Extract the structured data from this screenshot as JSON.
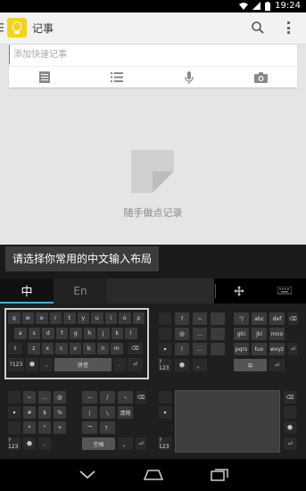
{
  "status": {
    "time": "19:24"
  },
  "app": {
    "title": "记事"
  },
  "note": {
    "placeholder": "添加快速记事"
  },
  "empty": {
    "text": "随手做点记录"
  },
  "keyboard": {
    "tooltip": "请选择你常用的中文输入布局",
    "tab_cn": "中",
    "tab_en": "En"
  },
  "layouts": {
    "qwerty": {
      "row1": [
        "q",
        "w",
        "e",
        "r",
        "t",
        "y",
        "u",
        "i",
        "o",
        "p"
      ],
      "row2": [
        "a",
        "s",
        "d",
        "f",
        "g",
        "h",
        "j",
        "k",
        "l"
      ],
      "row3": [
        "z",
        "x",
        "c",
        "v",
        "b",
        "n",
        "m"
      ],
      "row4": [
        "?123",
        "☻",
        ",",
        "拼音",
        ".",
        "⏎"
      ]
    },
    "nine_key": {
      "left": [
        "—",
        "~",
        "……"
      ],
      "row1": [
        "?",
        "~",
        "\"/",
        "abc",
        "def"
      ],
      "row2": [
        "@",
        "…",
        "ghi",
        "jkl",
        "mno"
      ],
      "row3": [
        "!",
        "…",
        "pqrs",
        "tuv",
        "wxyz"
      ],
      "row4": [
        "?123",
        "☻",
        "。",
        "中",
        "⏎"
      ]
    },
    "stroke": {
      "row1": [
        "~",
        "…",
        "@",
        "—",
        "/",
        "丶"
      ],
      "row2": [
        "#",
        "$",
        "%",
        "丨",
        "㇏",
        "清除"
      ],
      "row3": [
        "*",
        "\"",
        "+",
        "乛",
        "？"
      ],
      "row4": [
        "?123",
        "☻",
        ",",
        "空格",
        "。",
        "⏎"
      ]
    },
    "handwriting": {}
  },
  "colors": {
    "selected_tab_underline": "#33b5e5",
    "keyboard_bg": "#1a1a1a",
    "app_icon": "#f5d21e"
  }
}
